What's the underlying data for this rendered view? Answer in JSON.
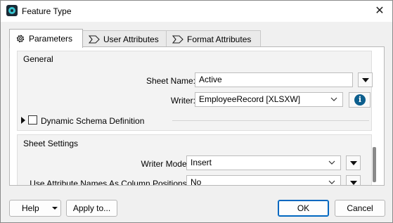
{
  "window": {
    "title": "Feature Type",
    "close_glyph": "✕"
  },
  "tabs": [
    {
      "label": "Parameters",
      "icon": "gear-icon",
      "active": true
    },
    {
      "label": "User Attributes",
      "icon": "tag-icon",
      "active": false
    },
    {
      "label": "Format Attributes",
      "icon": "tag-icon",
      "active": false
    }
  ],
  "general": {
    "title": "General",
    "sheet_name_label": "Sheet Name:",
    "sheet_name_value": "Active",
    "writer_label": "Writer:",
    "writer_value": "EmployeeRecord [XLSXW]",
    "info_glyph": "i",
    "dynamic_schema_label": "Dynamic Schema Definition",
    "dynamic_schema_checked": false
  },
  "sheet_settings": {
    "title": "Sheet Settings",
    "writer_mode_label": "Writer Mode:",
    "writer_mode_value": "Insert",
    "column_positions_label": "Use Attribute Names As Column Positions:",
    "column_positions_value": "No"
  },
  "footer": {
    "help_label": "Help",
    "apply_label": "Apply to...",
    "ok_label": "OK",
    "cancel_label": "Cancel"
  },
  "colors": {
    "primary_border": "#0067c0",
    "info_icon": "#0d5f8e",
    "app_icon": "#38c4d0"
  }
}
